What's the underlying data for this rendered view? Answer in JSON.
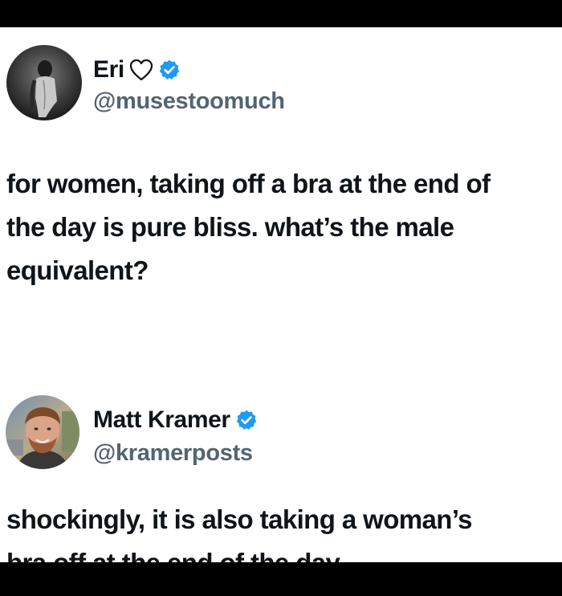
{
  "tweets": [
    {
      "display_name": "Eri",
      "handle": "@musestoomuch",
      "text_lines": [
        "for women, taking off a bra at the end of",
        "the day is pure bliss. what’s the male",
        "equivalent?"
      ]
    },
    {
      "display_name": "Matt Kramer",
      "handle": "@kramerposts",
      "text_lines": [
        "shockingly, it is also taking a woman’s",
        "bra off at the end of the day"
      ]
    }
  ],
  "icons": {
    "name_suffix_icon": "heart-outline-icon",
    "verified_icon": "verified-badge-icon"
  },
  "colors": {
    "background": "#ffffff",
    "text": "#0f1419",
    "handle": "#536471",
    "verified_badge": "#1d9bf0",
    "frame": "#000000"
  }
}
